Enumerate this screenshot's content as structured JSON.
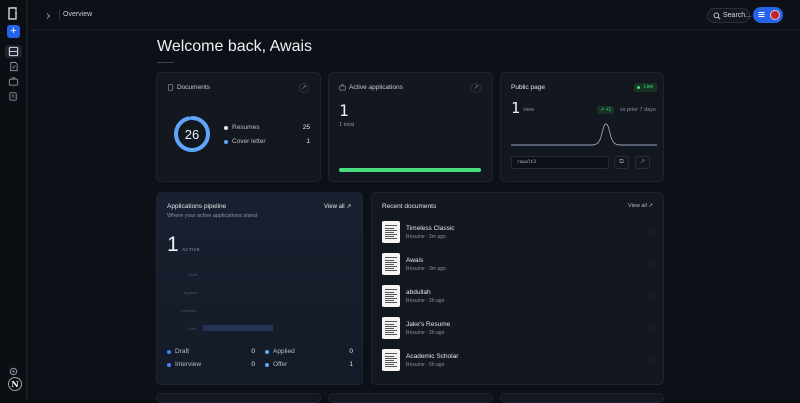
{
  "topbar": {
    "breadcrumb": "Overview",
    "search_label": "Search..."
  },
  "rail": {
    "user_initial": "N",
    "new_label": "+"
  },
  "welcome": "Welcome back, Awais",
  "documents_card": {
    "title": "Documents",
    "total": "26",
    "legend": [
      {
        "label": "Resumes",
        "value": "25",
        "color": "#e5e7eb"
      },
      {
        "label": "Cover letter",
        "value": "1",
        "color": "#60a5fa"
      }
    ],
    "ring_fraction": 0.96
  },
  "applications_card": {
    "title": "Active applications",
    "count": "1",
    "subtitle": "1 total",
    "progress": 1.0,
    "progress_color": "#4ade80"
  },
  "public_card": {
    "title": "Public page",
    "status": "Live",
    "views": "1",
    "views_label": "view",
    "delta": "↗ +1",
    "delta_label": "vs prior 7 days",
    "slug": "rawalt3"
  },
  "pipeline_card": {
    "title": "Applications pipeline",
    "subtitle": "Where your active applications stand",
    "view_all": "View all ↗",
    "count": "1",
    "count_label": "ACTIVE",
    "chart_data": {
      "type": "bar",
      "categories": [
        "Draft",
        "Applied",
        "Interview",
        "Offer"
      ],
      "values": [
        0,
        0,
        0,
        1
      ],
      "xlim": [
        0,
        1
      ]
    },
    "legend": [
      {
        "label": "Draft",
        "value": "0",
        "color": "#3b82f6"
      },
      {
        "label": "Applied",
        "value": "0",
        "color": "#60a5fa"
      },
      {
        "label": "Interview",
        "value": "0",
        "color": "#3b82f6"
      },
      {
        "label": "Offer",
        "value": "1",
        "color": "#60a5fa"
      }
    ]
  },
  "recent_card": {
    "title": "Recent documents",
    "view_all": "View all ↗",
    "docs": [
      {
        "name": "Timeless Classic",
        "meta": "Resume · 2m ago"
      },
      {
        "name": "Awais",
        "meta": "Resume · 3m ago"
      },
      {
        "name": "abdullah",
        "meta": "Resume · 2h ago"
      },
      {
        "name": "Jake's Resume",
        "meta": "Resume · 2h ago"
      },
      {
        "name": "Academic Scholar",
        "meta": "Resume · 5h ago"
      }
    ]
  }
}
